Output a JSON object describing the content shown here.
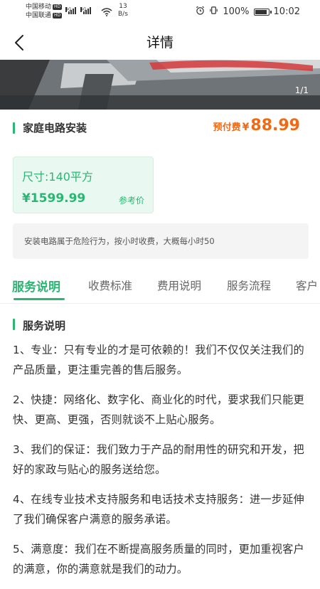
{
  "status_bar": {
    "carrier1": "中国移动",
    "carrier2": "中国联通",
    "hd_badge": "HD",
    "signal1_label": "4G",
    "signal2_label": "4G",
    "net_speed_value": "13",
    "net_speed_unit": "B/s",
    "battery_percent": "100%",
    "battery_level": 1.0,
    "time": "10:02",
    "icons": [
      "alarm-icon",
      "vibrate-icon",
      "wifi-icon",
      "battery-icon"
    ]
  },
  "header": {
    "title": "详情",
    "back_icon": "chevron-left-icon"
  },
  "banner": {
    "counter": "1/1"
  },
  "service": {
    "name": "家庭电路安装",
    "prepay_label": "预付费",
    "currency": "¥",
    "prepay_amount": "88.99"
  },
  "size_card": {
    "size_label": "尺寸:140平方",
    "price": "¥1599.99",
    "reference_label": "参考价"
  },
  "note": "安装电路属于危险行为，按小时收费，大概每小时50",
  "tabs": [
    {
      "label": "服务说明",
      "active": true
    },
    {
      "label": "收费标准",
      "active": false
    },
    {
      "label": "费用说明",
      "active": false
    },
    {
      "label": "服务流程",
      "active": false
    },
    {
      "label": "客户",
      "active": false
    }
  ],
  "content": {
    "section_title": "服务说明",
    "paragraphs": [
      "1、专业：只有专业的才是可依赖的！我们不仅仅关注我们的产品质量，更注重完善的售后服务。",
      "2、快捷：网络化、数字化、商业化的时代，要求我们只能更快、更高、更强，否则就谈不上贴心服务。",
      "3、我们的保证：我们致力于产品的耐用性的研究和开发，把好的家政与贴心的服务送给您。",
      "4、在线专业技术支持服务和电话技术支持服务：进一步延伸了我们确保客户满意的服务承诺。",
      "5、满意度：我们在不断提高服务质量的同时，更加重视客户的满意，你的满意就是我们的动力。"
    ]
  },
  "colors": {
    "accent_green": "#2bb673",
    "price_orange": "#f06a16",
    "card_bg": "#e9f8f0",
    "note_bg": "#f4f4f4"
  }
}
